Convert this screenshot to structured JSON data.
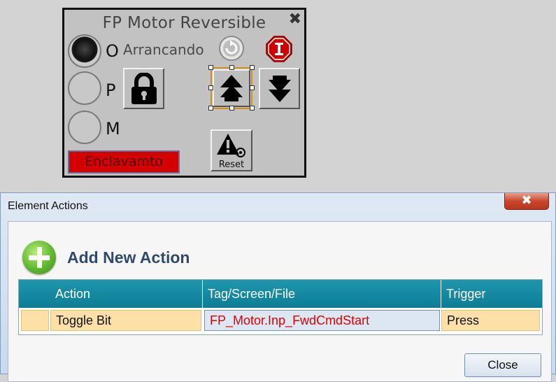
{
  "faceplate": {
    "title": "FP Motor Reversible",
    "close_glyph": "✖",
    "modes": [
      {
        "label": "O",
        "active": true
      },
      {
        "label": "P",
        "active": false
      },
      {
        "label": "M",
        "active": false
      }
    ],
    "status_text": "Arrancando",
    "interlock_label": "Enclavamto",
    "reset_label": "Reset",
    "icons": [
      "refresh-icon",
      "interlock-stop-icon",
      "lock-icon",
      "forward-arrow-icon",
      "reverse-arrow-icon",
      "reset-warning-icon"
    ],
    "colors": {
      "interlock_bar": "#d40000",
      "stop_octagon": "#d40000",
      "selection": "#d4921c"
    }
  },
  "dialog": {
    "title": "Element Actions",
    "close_glyph": "✖",
    "add_action_label": "Add New Action",
    "columns": [
      "",
      "Action",
      "Tag/Screen/File",
      "Trigger"
    ],
    "rows": [
      {
        "marker": "",
        "action": "Toggle Bit",
        "tag": "FP_Motor.Inp_FwdCmdStart",
        "trigger": "Press"
      }
    ],
    "close_button": "Close",
    "colors": {
      "header": "#1a8ea6",
      "row": "#fde0a8",
      "tag_text": "#e00000"
    }
  }
}
